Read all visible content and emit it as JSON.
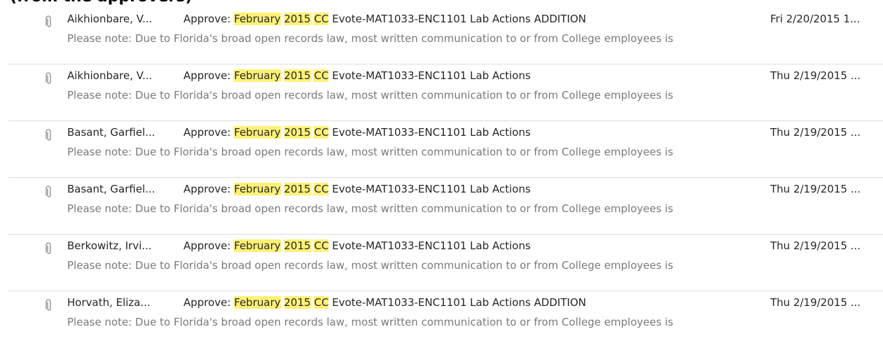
{
  "header_text": "(from the approvers)",
  "highlight_color": "#fff176",
  "icons": {
    "attachment": "paperclip-icon"
  },
  "messages": [
    {
      "sender": "Aikhionbare, V...",
      "subject_prefix": "Approve:",
      "hl1": "February",
      "hl2": "2015",
      "hl3": "CC",
      "subject_rest": "Evote-MAT1033-ENC1101 Lab Actions ADDITION",
      "date": "Fri 2/20/2015 1...",
      "preview": "Please note: Due to Florida's broad open records law, most written communication to or from College employees is"
    },
    {
      "sender": "Aikhionbare, V...",
      "subject_prefix": "Approve:",
      "hl1": "February",
      "hl2": "2015",
      "hl3": "CC",
      "subject_rest": "Evote-MAT1033-ENC1101 Lab Actions",
      "date": "Thu 2/19/2015 ...",
      "preview": "Please note: Due to Florida's broad open records law, most written communication to or from College employees is"
    },
    {
      "sender": "Basant, Garfiel...",
      "subject_prefix": "Approve:",
      "hl1": "February",
      "hl2": "2015",
      "hl3": "CC",
      "subject_rest": "Evote-MAT1033-ENC1101 Lab Actions",
      "date": "Thu 2/19/2015 ...",
      "preview": "Please note: Due to Florida's broad open records law, most written communication to or from College employees is"
    },
    {
      "sender": "Basant, Garfiel...",
      "subject_prefix": "Approve:",
      "hl1": "February",
      "hl2": "2015",
      "hl3": "CC",
      "subject_rest": "Evote-MAT1033-ENC1101 Lab Actions",
      "date": "Thu 2/19/2015 ...",
      "preview": "Please note: Due to Florida's broad open records law, most written communication to or from College employees is"
    },
    {
      "sender": "Berkowitz, Irvi...",
      "subject_prefix": "Approve:",
      "hl1": "February",
      "hl2": "2015",
      "hl3": "CC",
      "subject_rest": "Evote-MAT1033-ENC1101 Lab Actions",
      "date": "Thu 2/19/2015 ...",
      "preview": "Please note: Due to Florida's broad open records law, most written communication to or from College employees is"
    },
    {
      "sender": "Horvath, Eliza...",
      "subject_prefix": "Approve:",
      "hl1": "February",
      "hl2": "2015",
      "hl3": "CC",
      "subject_rest": "Evote-MAT1033-ENC1101 Lab Actions ADDITION",
      "date": "Thu 2/19/2015 ...",
      "preview": "Please note: Due to Florida's broad open records law, most written communication to or from College employees is"
    }
  ]
}
